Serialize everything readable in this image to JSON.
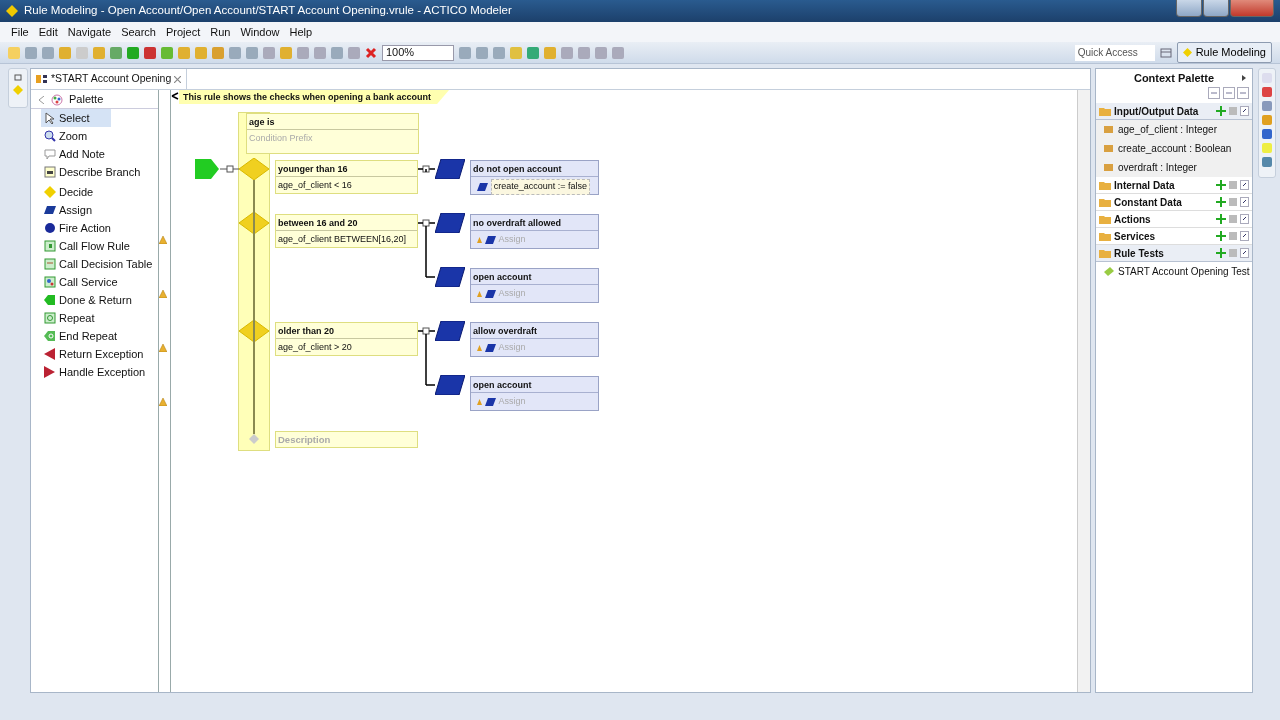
{
  "window": {
    "title": "Rule Modeling - Open Account/Open Account/START Account Opening.vrule - ACTICO Modeler"
  },
  "menu": [
    "File",
    "Edit",
    "Navigate",
    "Search",
    "Project",
    "Run",
    "Window",
    "Help"
  ],
  "toolbar": {
    "zoom": "100%",
    "quick_access": {
      "placeholder": "Quick Access"
    },
    "perspective": "Rule Modeling"
  },
  "editor_tab": {
    "label": "*START Account Opening"
  },
  "palette": {
    "title": "Palette",
    "items": [
      {
        "label": "Select",
        "kind": "select",
        "selected": true
      },
      {
        "label": "Zoom",
        "kind": "zoom",
        "selected": false
      },
      {
        "label": "Add Note",
        "kind": "note",
        "selected": false
      },
      {
        "label": "Describe Branch",
        "kind": "describe",
        "selected": false
      },
      {
        "label": "Decide",
        "kind": "decide",
        "selected": false
      },
      {
        "label": "Assign",
        "kind": "assign",
        "selected": false
      },
      {
        "label": "Fire Action",
        "kind": "fire",
        "selected": false
      },
      {
        "label": "Call Flow Rule",
        "kind": "callflow",
        "selected": false
      },
      {
        "label": "Call Decision Table",
        "kind": "calltable",
        "selected": false
      },
      {
        "label": "Call Service",
        "kind": "callservice",
        "selected": false
      },
      {
        "label": "Done & Return",
        "kind": "done",
        "selected": false
      },
      {
        "label": "Repeat",
        "kind": "repeat",
        "selected": false
      },
      {
        "label": "End Repeat",
        "kind": "endrepeat",
        "selected": false
      },
      {
        "label": "Return Exception",
        "kind": "retexc",
        "selected": false
      },
      {
        "label": "Handle Exception",
        "kind": "handexc",
        "selected": false
      }
    ]
  },
  "diagram": {
    "note": "This rule shows the checks when opening a bank account",
    "decision": {
      "title": "age is",
      "prefix": {
        "placeholder": "Condition Prefix"
      }
    },
    "branches": [
      {
        "title": "younger than 16",
        "condition": "age_of_client < 16",
        "actions": [
          {
            "title": "do not open account",
            "value": "create_account := false",
            "warning": false
          }
        ]
      },
      {
        "title": "between 16 and 20",
        "condition": "age_of_client BETWEEN[16,20]",
        "actions": [
          {
            "title": "no overdraft allowed",
            "placeholder": "Assign",
            "warning": true
          },
          {
            "title": "open account",
            "placeholder": "Assign",
            "warning": true
          }
        ]
      },
      {
        "title": "older than 20",
        "condition": "age_of_client > 20",
        "actions": [
          {
            "title": "allow overdraft",
            "placeholder": "Assign",
            "warning": true
          },
          {
            "title": "open account",
            "placeholder": "Assign",
            "warning": true
          }
        ]
      }
    ],
    "description": {
      "placeholder": "Description"
    }
  },
  "context_palette": {
    "title": "Context Palette",
    "sections": [
      {
        "label": "Input/Output Data",
        "expanded": true,
        "items": [
          "age_of_client : Integer",
          "create_account : Boolean",
          "overdraft : Integer"
        ]
      },
      {
        "label": "Internal Data",
        "expanded": false
      },
      {
        "label": "Constant Data",
        "expanded": false
      },
      {
        "label": "Actions",
        "expanded": false
      },
      {
        "label": "Services",
        "expanded": false
      },
      {
        "label": "Rule Tests",
        "expanded": true,
        "items": [
          "START Account Opening Test"
        ]
      }
    ]
  }
}
